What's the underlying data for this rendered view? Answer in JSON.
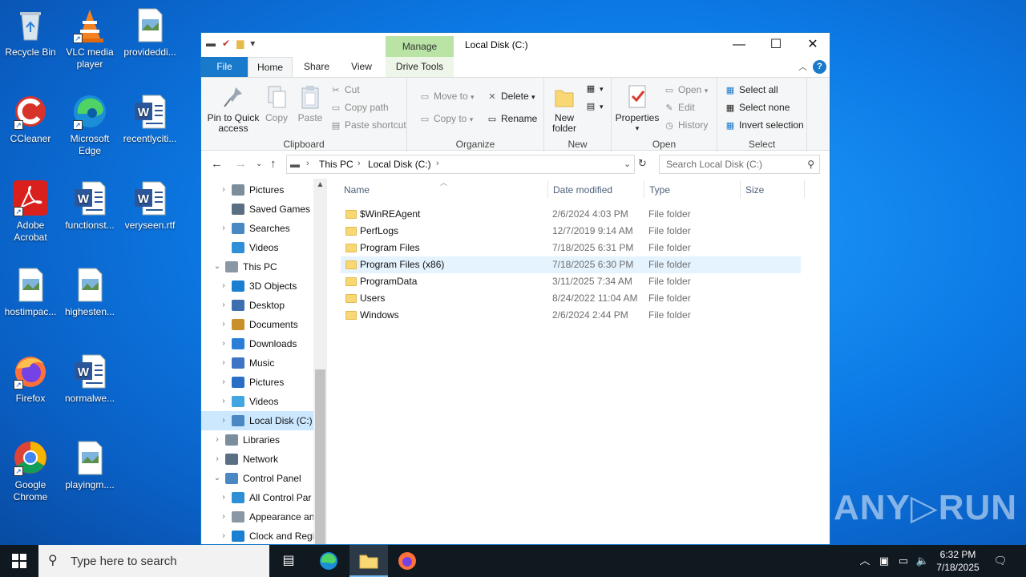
{
  "desktop": {
    "icons": [
      {
        "label": "Recycle Bin",
        "icon": "recycle-bin-icon"
      },
      {
        "label": "VLC media player",
        "icon": "vlc-icon"
      },
      {
        "label": "provideddi...",
        "icon": "image-file-icon"
      },
      {
        "label": "CCleaner",
        "icon": "ccleaner-icon"
      },
      {
        "label": "Microsoft Edge",
        "icon": "edge-icon"
      },
      {
        "label": "recentlyciti...",
        "icon": "word-doc-icon"
      },
      {
        "label": "Adobe Acrobat",
        "icon": "acrobat-icon"
      },
      {
        "label": "functionst...",
        "icon": "word-doc-icon"
      },
      {
        "label": "veryseen.rtf",
        "icon": "word-doc-icon"
      },
      {
        "label": "hostimpac...",
        "icon": "image-file-icon"
      },
      {
        "label": "highesten...",
        "icon": "image-file-icon"
      },
      {
        "label": "Firefox",
        "icon": "firefox-icon"
      },
      {
        "label": "normalwe...",
        "icon": "word-doc-icon"
      },
      {
        "label": "Google Chrome",
        "icon": "chrome-icon"
      },
      {
        "label": "playingm....",
        "icon": "image-file-icon"
      }
    ]
  },
  "window": {
    "title": "Local Disk (C:)",
    "contextual_tab_group": "Manage",
    "tabs": {
      "file": "File",
      "home": "Home",
      "share": "Share",
      "view": "View",
      "drive_tools": "Drive Tools"
    },
    "controls": {
      "minimize": "—",
      "maximize": "☐",
      "close": "✕"
    },
    "help": "?"
  },
  "ribbon": {
    "clipboard": {
      "label": "Clipboard",
      "pin": "Pin to Quick access",
      "copy": "Copy",
      "paste": "Paste",
      "cut": "Cut",
      "copy_path": "Copy path",
      "paste_shortcut": "Paste shortcut"
    },
    "organize": {
      "label": "Organize",
      "move_to": "Move to",
      "copy_to": "Copy to",
      "delete": "Delete",
      "rename": "Rename"
    },
    "new": {
      "label": "New",
      "new_folder": "New folder"
    },
    "open": {
      "label": "Open",
      "properties": "Properties",
      "open": "Open",
      "edit": "Edit",
      "history": "History"
    },
    "select": {
      "label": "Select",
      "select_all": "Select all",
      "select_none": "Select none",
      "invert": "Invert selection"
    }
  },
  "address": {
    "crumbs": [
      "This PC",
      "Local Disk (C:)"
    ],
    "search_placeholder": "Search Local Disk (C:)"
  },
  "navpane": {
    "items": [
      {
        "label": "Pictures",
        "indent": 1,
        "chevron": "›"
      },
      {
        "label": "Saved Games",
        "indent": 1,
        "chevron": ""
      },
      {
        "label": "Searches",
        "indent": 1,
        "chevron": "›"
      },
      {
        "label": "Videos",
        "indent": 1,
        "chevron": ""
      },
      {
        "label": "This PC",
        "indent": 0,
        "chevron": "⌄"
      },
      {
        "label": "3D Objects",
        "indent": 1,
        "chevron": "›"
      },
      {
        "label": "Desktop",
        "indent": 1,
        "chevron": "›"
      },
      {
        "label": "Documents",
        "indent": 1,
        "chevron": "›"
      },
      {
        "label": "Downloads",
        "indent": 1,
        "chevron": "›"
      },
      {
        "label": "Music",
        "indent": 1,
        "chevron": "›"
      },
      {
        "label": "Pictures",
        "indent": 1,
        "chevron": "›"
      },
      {
        "label": "Videos",
        "indent": 1,
        "chevron": "›"
      },
      {
        "label": "Local Disk (C:)",
        "indent": 1,
        "chevron": "›"
      },
      {
        "label": "Libraries",
        "indent": 0,
        "chevron": "›"
      },
      {
        "label": "Network",
        "indent": 0,
        "chevron": "›"
      },
      {
        "label": "Control Panel",
        "indent": 0,
        "chevron": "⌄"
      },
      {
        "label": "All Control Par",
        "indent": 1,
        "chevron": "›"
      },
      {
        "label": "Appearance an",
        "indent": 1,
        "chevron": "›"
      },
      {
        "label": "Clock and Regi",
        "indent": 1,
        "chevron": "›"
      }
    ]
  },
  "filelist": {
    "columns": {
      "name": "Name",
      "date": "Date modified",
      "type": "Type",
      "size": "Size"
    },
    "rows": [
      {
        "name": "$WinREAgent",
        "date": "2/6/2024 4:03 PM",
        "type": "File folder"
      },
      {
        "name": "PerfLogs",
        "date": "12/7/2019 9:14 AM",
        "type": "File folder"
      },
      {
        "name": "Program Files",
        "date": "7/18/2025 6:31 PM",
        "type": "File folder"
      },
      {
        "name": "Program Files (x86)",
        "date": "7/18/2025 6:30 PM",
        "type": "File folder"
      },
      {
        "name": "ProgramData",
        "date": "3/11/2025 7:34 AM",
        "type": "File folder"
      },
      {
        "name": "Users",
        "date": "8/24/2022 11:04 AM",
        "type": "File folder"
      },
      {
        "name": "Windows",
        "date": "2/6/2024 2:44 PM",
        "type": "File folder"
      }
    ]
  },
  "taskbar": {
    "search_placeholder": "Type here to search",
    "time": "6:32 PM",
    "date": "7/18/2025"
  },
  "watermark": "ANY▷RUN"
}
